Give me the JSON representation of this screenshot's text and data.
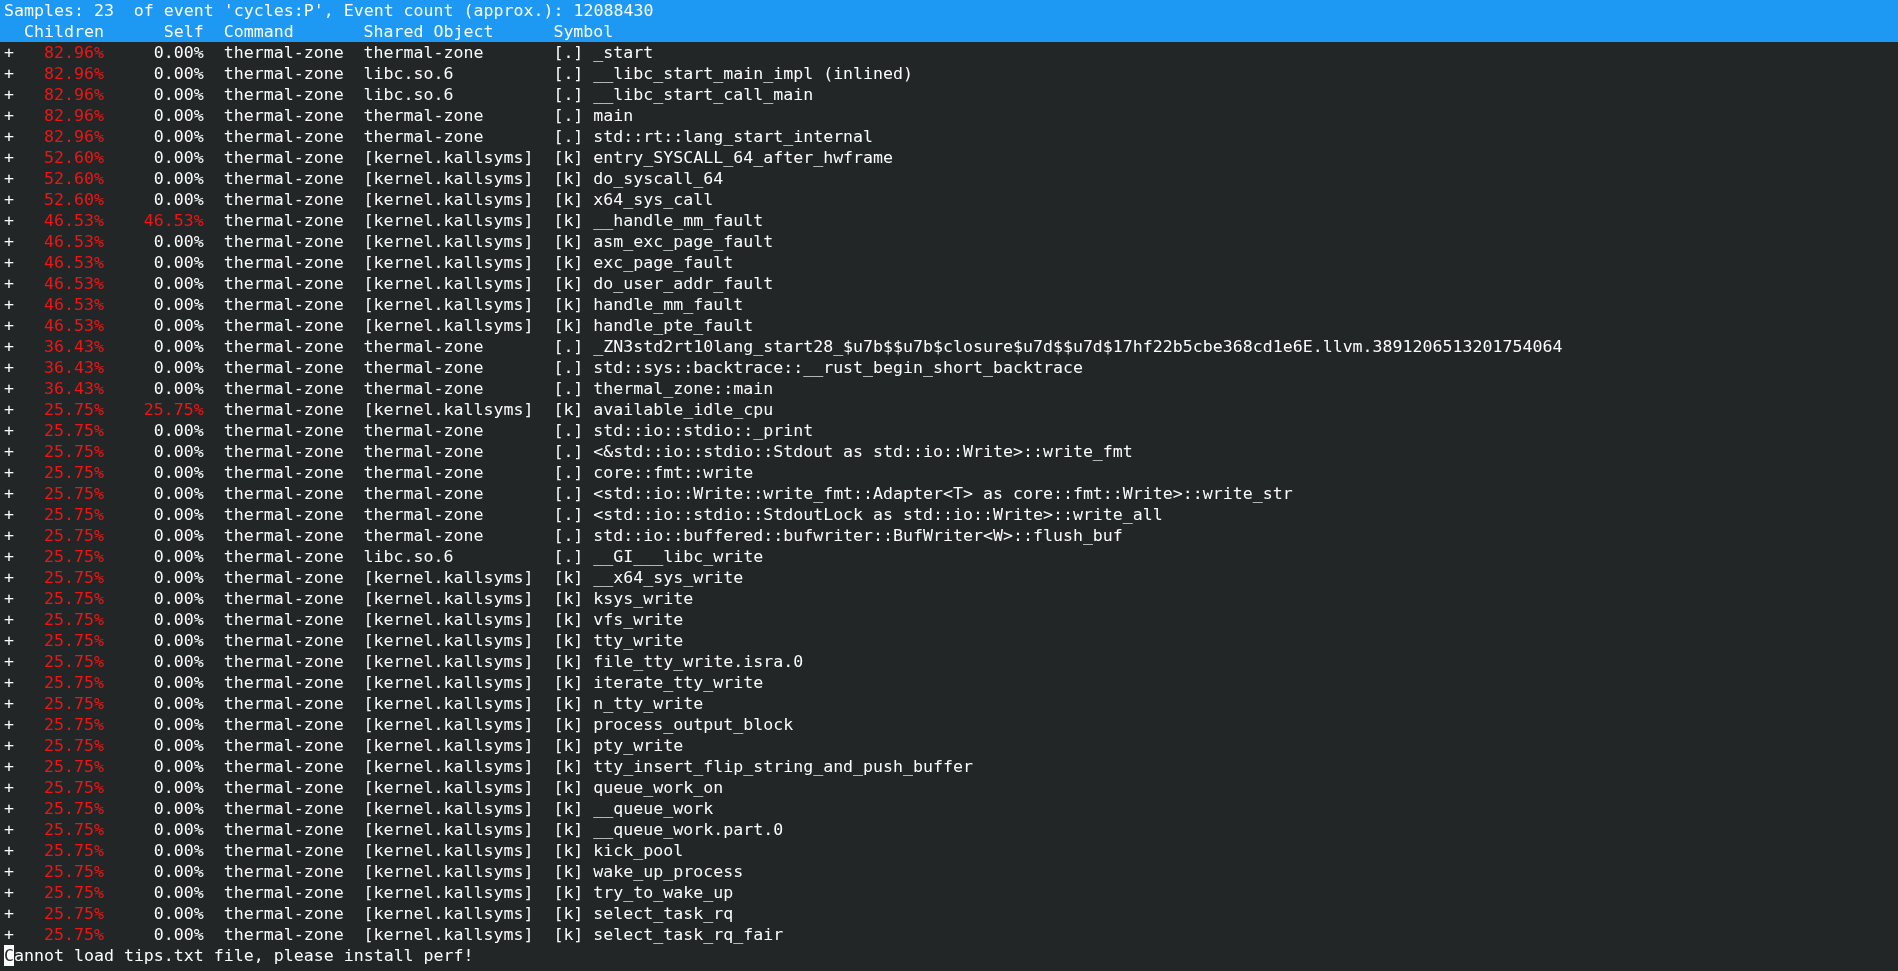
{
  "title": "Samples: 23  of event 'cycles:P', Event count (approx.): 12088430",
  "columns": {
    "children": "Children",
    "self": "Self",
    "command": "Command",
    "shared_object": "Shared Object",
    "symbol": "Symbol"
  },
  "rows": [
    {
      "marker": "+",
      "children": "82.96%",
      "children_hot": true,
      "self": "0.00%",
      "self_hot": false,
      "command": "thermal-zone",
      "shared_object": "thermal-zone",
      "type": "[.]",
      "symbol": "_start"
    },
    {
      "marker": "+",
      "children": "82.96%",
      "children_hot": true,
      "self": "0.00%",
      "self_hot": false,
      "command": "thermal-zone",
      "shared_object": "libc.so.6",
      "type": "[.]",
      "symbol": "__libc_start_main_impl (inlined)"
    },
    {
      "marker": "+",
      "children": "82.96%",
      "children_hot": true,
      "self": "0.00%",
      "self_hot": false,
      "command": "thermal-zone",
      "shared_object": "libc.so.6",
      "type": "[.]",
      "symbol": "__libc_start_call_main"
    },
    {
      "marker": "+",
      "children": "82.96%",
      "children_hot": true,
      "self": "0.00%",
      "self_hot": false,
      "command": "thermal-zone",
      "shared_object": "thermal-zone",
      "type": "[.]",
      "symbol": "main"
    },
    {
      "marker": "+",
      "children": "82.96%",
      "children_hot": true,
      "self": "0.00%",
      "self_hot": false,
      "command": "thermal-zone",
      "shared_object": "thermal-zone",
      "type": "[.]",
      "symbol": "std::rt::lang_start_internal"
    },
    {
      "marker": "+",
      "children": "52.60%",
      "children_hot": true,
      "self": "0.00%",
      "self_hot": false,
      "command": "thermal-zone",
      "shared_object": "[kernel.kallsyms]",
      "type": "[k]",
      "symbol": "entry_SYSCALL_64_after_hwframe"
    },
    {
      "marker": "+",
      "children": "52.60%",
      "children_hot": true,
      "self": "0.00%",
      "self_hot": false,
      "command": "thermal-zone",
      "shared_object": "[kernel.kallsyms]",
      "type": "[k]",
      "symbol": "do_syscall_64"
    },
    {
      "marker": "+",
      "children": "52.60%",
      "children_hot": true,
      "self": "0.00%",
      "self_hot": false,
      "command": "thermal-zone",
      "shared_object": "[kernel.kallsyms]",
      "type": "[k]",
      "symbol": "x64_sys_call"
    },
    {
      "marker": "+",
      "children": "46.53%",
      "children_hot": true,
      "self": "46.53%",
      "self_hot": true,
      "command": "thermal-zone",
      "shared_object": "[kernel.kallsyms]",
      "type": "[k]",
      "symbol": "__handle_mm_fault"
    },
    {
      "marker": "+",
      "children": "46.53%",
      "children_hot": true,
      "self": "0.00%",
      "self_hot": false,
      "command": "thermal-zone",
      "shared_object": "[kernel.kallsyms]",
      "type": "[k]",
      "symbol": "asm_exc_page_fault"
    },
    {
      "marker": "+",
      "children": "46.53%",
      "children_hot": true,
      "self": "0.00%",
      "self_hot": false,
      "command": "thermal-zone",
      "shared_object": "[kernel.kallsyms]",
      "type": "[k]",
      "symbol": "exc_page_fault"
    },
    {
      "marker": "+",
      "children": "46.53%",
      "children_hot": true,
      "self": "0.00%",
      "self_hot": false,
      "command": "thermal-zone",
      "shared_object": "[kernel.kallsyms]",
      "type": "[k]",
      "symbol": "do_user_addr_fault"
    },
    {
      "marker": "+",
      "children": "46.53%",
      "children_hot": true,
      "self": "0.00%",
      "self_hot": false,
      "command": "thermal-zone",
      "shared_object": "[kernel.kallsyms]",
      "type": "[k]",
      "symbol": "handle_mm_fault"
    },
    {
      "marker": "+",
      "children": "46.53%",
      "children_hot": true,
      "self": "0.00%",
      "self_hot": false,
      "command": "thermal-zone",
      "shared_object": "[kernel.kallsyms]",
      "type": "[k]",
      "symbol": "handle_pte_fault"
    },
    {
      "marker": "+",
      "children": "36.43%",
      "children_hot": true,
      "self": "0.00%",
      "self_hot": false,
      "command": "thermal-zone",
      "shared_object": "thermal-zone",
      "type": "[.]",
      "symbol": "_ZN3std2rt10lang_start28_$u7b$$u7b$closure$u7d$$u7d$17hf22b5cbe368cd1e6E.llvm.3891206513201754064"
    },
    {
      "marker": "+",
      "children": "36.43%",
      "children_hot": true,
      "self": "0.00%",
      "self_hot": false,
      "command": "thermal-zone",
      "shared_object": "thermal-zone",
      "type": "[.]",
      "symbol": "std::sys::backtrace::__rust_begin_short_backtrace"
    },
    {
      "marker": "+",
      "children": "36.43%",
      "children_hot": true,
      "self": "0.00%",
      "self_hot": false,
      "command": "thermal-zone",
      "shared_object": "thermal-zone",
      "type": "[.]",
      "symbol": "thermal_zone::main"
    },
    {
      "marker": "+",
      "children": "25.75%",
      "children_hot": true,
      "self": "25.75%",
      "self_hot": true,
      "command": "thermal-zone",
      "shared_object": "[kernel.kallsyms]",
      "type": "[k]",
      "symbol": "available_idle_cpu"
    },
    {
      "marker": "+",
      "children": "25.75%",
      "children_hot": true,
      "self": "0.00%",
      "self_hot": false,
      "command": "thermal-zone",
      "shared_object": "thermal-zone",
      "type": "[.]",
      "symbol": "std::io::stdio::_print"
    },
    {
      "marker": "+",
      "children": "25.75%",
      "children_hot": true,
      "self": "0.00%",
      "self_hot": false,
      "command": "thermal-zone",
      "shared_object": "thermal-zone",
      "type": "[.]",
      "symbol": "<&std::io::stdio::Stdout as std::io::Write>::write_fmt"
    },
    {
      "marker": "+",
      "children": "25.75%",
      "children_hot": true,
      "self": "0.00%",
      "self_hot": false,
      "command": "thermal-zone",
      "shared_object": "thermal-zone",
      "type": "[.]",
      "symbol": "core::fmt::write"
    },
    {
      "marker": "+",
      "children": "25.75%",
      "children_hot": true,
      "self": "0.00%",
      "self_hot": false,
      "command": "thermal-zone",
      "shared_object": "thermal-zone",
      "type": "[.]",
      "symbol": "<std::io::Write::write_fmt::Adapter<T> as core::fmt::Write>::write_str"
    },
    {
      "marker": "+",
      "children": "25.75%",
      "children_hot": true,
      "self": "0.00%",
      "self_hot": false,
      "command": "thermal-zone",
      "shared_object": "thermal-zone",
      "type": "[.]",
      "symbol": "<std::io::stdio::StdoutLock as std::io::Write>::write_all"
    },
    {
      "marker": "+",
      "children": "25.75%",
      "children_hot": true,
      "self": "0.00%",
      "self_hot": false,
      "command": "thermal-zone",
      "shared_object": "thermal-zone",
      "type": "[.]",
      "symbol": "std::io::buffered::bufwriter::BufWriter<W>::flush_buf"
    },
    {
      "marker": "+",
      "children": "25.75%",
      "children_hot": true,
      "self": "0.00%",
      "self_hot": false,
      "command": "thermal-zone",
      "shared_object": "libc.so.6",
      "type": "[.]",
      "symbol": "__GI___libc_write"
    },
    {
      "marker": "+",
      "children": "25.75%",
      "children_hot": true,
      "self": "0.00%",
      "self_hot": false,
      "command": "thermal-zone",
      "shared_object": "[kernel.kallsyms]",
      "type": "[k]",
      "symbol": "__x64_sys_write"
    },
    {
      "marker": "+",
      "children": "25.75%",
      "children_hot": true,
      "self": "0.00%",
      "self_hot": false,
      "command": "thermal-zone",
      "shared_object": "[kernel.kallsyms]",
      "type": "[k]",
      "symbol": "ksys_write"
    },
    {
      "marker": "+",
      "children": "25.75%",
      "children_hot": true,
      "self": "0.00%",
      "self_hot": false,
      "command": "thermal-zone",
      "shared_object": "[kernel.kallsyms]",
      "type": "[k]",
      "symbol": "vfs_write"
    },
    {
      "marker": "+",
      "children": "25.75%",
      "children_hot": true,
      "self": "0.00%",
      "self_hot": false,
      "command": "thermal-zone",
      "shared_object": "[kernel.kallsyms]",
      "type": "[k]",
      "symbol": "tty_write"
    },
    {
      "marker": "+",
      "children": "25.75%",
      "children_hot": true,
      "self": "0.00%",
      "self_hot": false,
      "command": "thermal-zone",
      "shared_object": "[kernel.kallsyms]",
      "type": "[k]",
      "symbol": "file_tty_write.isra.0"
    },
    {
      "marker": "+",
      "children": "25.75%",
      "children_hot": true,
      "self": "0.00%",
      "self_hot": false,
      "command": "thermal-zone",
      "shared_object": "[kernel.kallsyms]",
      "type": "[k]",
      "symbol": "iterate_tty_write"
    },
    {
      "marker": "+",
      "children": "25.75%",
      "children_hot": true,
      "self": "0.00%",
      "self_hot": false,
      "command": "thermal-zone",
      "shared_object": "[kernel.kallsyms]",
      "type": "[k]",
      "symbol": "n_tty_write"
    },
    {
      "marker": "+",
      "children": "25.75%",
      "children_hot": true,
      "self": "0.00%",
      "self_hot": false,
      "command": "thermal-zone",
      "shared_object": "[kernel.kallsyms]",
      "type": "[k]",
      "symbol": "process_output_block"
    },
    {
      "marker": "+",
      "children": "25.75%",
      "children_hot": true,
      "self": "0.00%",
      "self_hot": false,
      "command": "thermal-zone",
      "shared_object": "[kernel.kallsyms]",
      "type": "[k]",
      "symbol": "pty_write"
    },
    {
      "marker": "+",
      "children": "25.75%",
      "children_hot": true,
      "self": "0.00%",
      "self_hot": false,
      "command": "thermal-zone",
      "shared_object": "[kernel.kallsyms]",
      "type": "[k]",
      "symbol": "tty_insert_flip_string_and_push_buffer"
    },
    {
      "marker": "+",
      "children": "25.75%",
      "children_hot": true,
      "self": "0.00%",
      "self_hot": false,
      "command": "thermal-zone",
      "shared_object": "[kernel.kallsyms]",
      "type": "[k]",
      "symbol": "queue_work_on"
    },
    {
      "marker": "+",
      "children": "25.75%",
      "children_hot": true,
      "self": "0.00%",
      "self_hot": false,
      "command": "thermal-zone",
      "shared_object": "[kernel.kallsyms]",
      "type": "[k]",
      "symbol": "__queue_work"
    },
    {
      "marker": "+",
      "children": "25.75%",
      "children_hot": true,
      "self": "0.00%",
      "self_hot": false,
      "command": "thermal-zone",
      "shared_object": "[kernel.kallsyms]",
      "type": "[k]",
      "symbol": "__queue_work.part.0"
    },
    {
      "marker": "+",
      "children": "25.75%",
      "children_hot": true,
      "self": "0.00%",
      "self_hot": false,
      "command": "thermal-zone",
      "shared_object": "[kernel.kallsyms]",
      "type": "[k]",
      "symbol": "kick_pool"
    },
    {
      "marker": "+",
      "children": "25.75%",
      "children_hot": true,
      "self": "0.00%",
      "self_hot": false,
      "command": "thermal-zone",
      "shared_object": "[kernel.kallsyms]",
      "type": "[k]",
      "symbol": "wake_up_process"
    },
    {
      "marker": "+",
      "children": "25.75%",
      "children_hot": true,
      "self": "0.00%",
      "self_hot": false,
      "command": "thermal-zone",
      "shared_object": "[kernel.kallsyms]",
      "type": "[k]",
      "symbol": "try_to_wake_up"
    },
    {
      "marker": "+",
      "children": "25.75%",
      "children_hot": true,
      "self": "0.00%",
      "self_hot": false,
      "command": "thermal-zone",
      "shared_object": "[kernel.kallsyms]",
      "type": "[k]",
      "symbol": "select_task_rq"
    },
    {
      "marker": "+",
      "children": "25.75%",
      "children_hot": true,
      "self": "0.00%",
      "self_hot": false,
      "command": "thermal-zone",
      "shared_object": "[kernel.kallsyms]",
      "type": "[k]",
      "symbol": "select_task_rq_fair"
    }
  ],
  "status_line": "Cannot load tips.txt file, please install perf!"
}
